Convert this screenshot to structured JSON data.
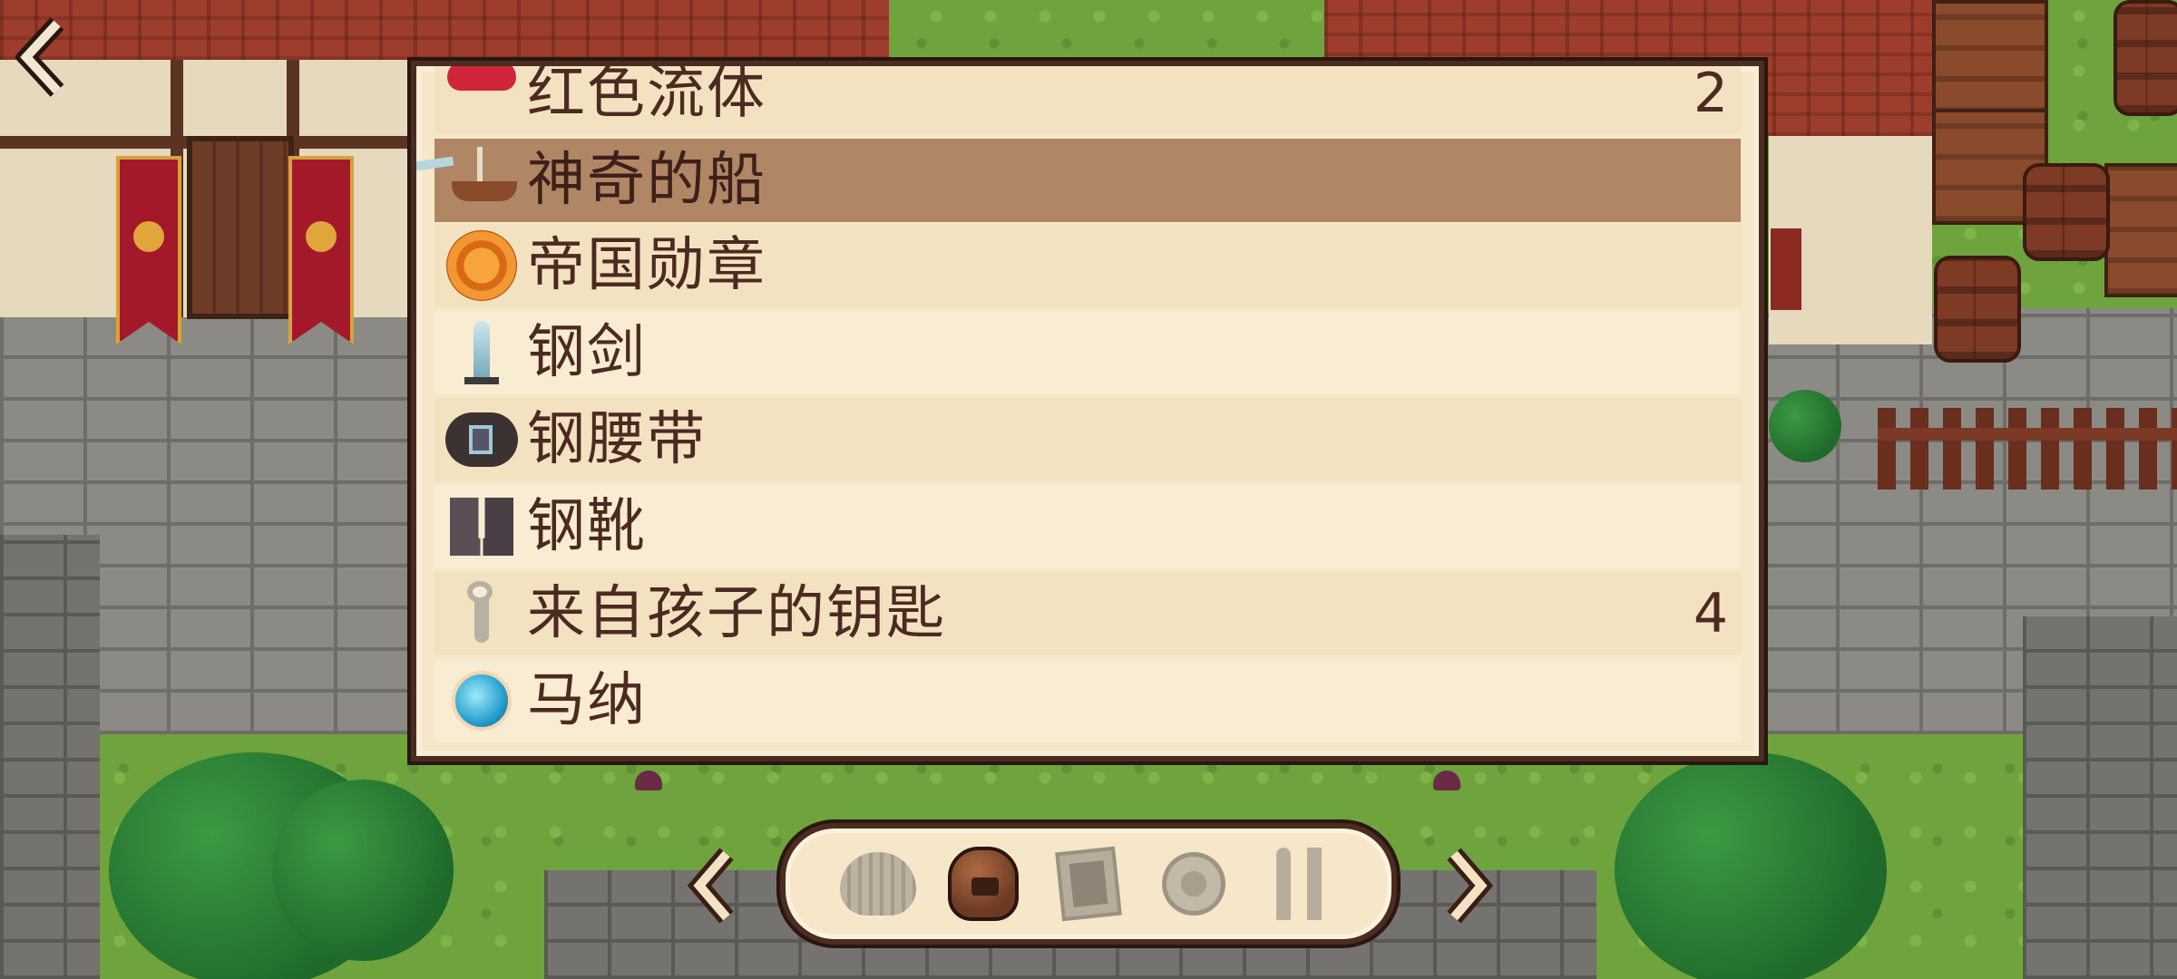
{
  "inventory": {
    "items": [
      {
        "name": "红色流体",
        "count": "2",
        "icon": "red-fluid-icon"
      },
      {
        "name": "神奇的船",
        "count": "",
        "icon": "magic-ship-icon",
        "selected": true
      },
      {
        "name": "帝国勋章",
        "count": "",
        "icon": "imperial-medal-icon"
      },
      {
        "name": "钢剑",
        "count": "",
        "icon": "steel-sword-icon"
      },
      {
        "name": "钢腰带",
        "count": "",
        "icon": "steel-belt-icon"
      },
      {
        "name": "钢靴",
        "count": "",
        "icon": "steel-boots-icon"
      },
      {
        "name": "来自孩子的钥匙",
        "count": "4",
        "icon": "key-icon"
      },
      {
        "name": "马纳",
        "count": "",
        "icon": "mana-orb-icon"
      }
    ]
  },
  "category_bar": {
    "tabs": [
      {
        "icon": "helmet-icon",
        "active": false
      },
      {
        "icon": "bag-icon",
        "active": true
      },
      {
        "icon": "cards-icon",
        "active": false
      },
      {
        "icon": "bomb-icon",
        "active": false
      },
      {
        "icon": "tools-icon",
        "active": false
      }
    ]
  },
  "colors": {
    "panel_bg": "#f6e7c8",
    "row_selected": "#b08665",
    "text": "#4b2a22",
    "border": "#4b2c21"
  }
}
